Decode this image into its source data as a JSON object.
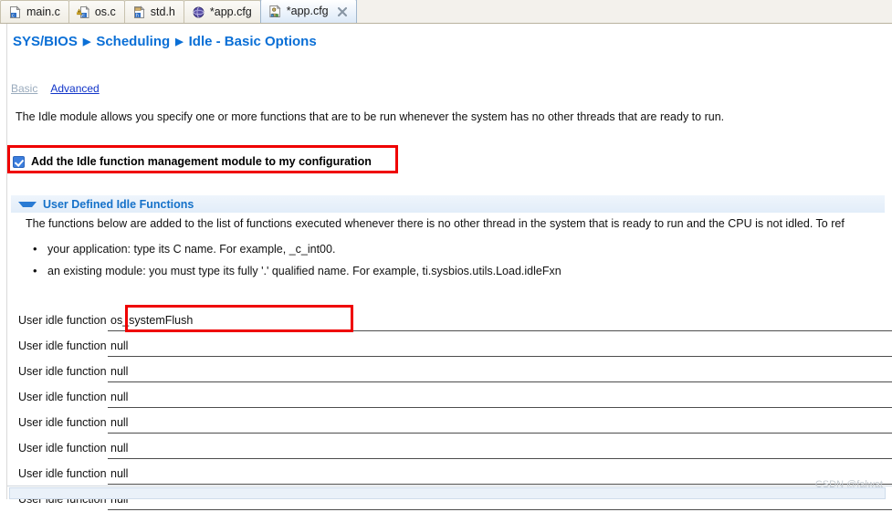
{
  "tabs": [
    {
      "label": "main.c",
      "icon": "c-file-icon",
      "active": false,
      "closable": false
    },
    {
      "label": "os.c",
      "icon": "c-file-warning-icon",
      "active": false,
      "closable": false
    },
    {
      "label": "std.h",
      "icon": "h-file-icon",
      "active": false,
      "closable": false
    },
    {
      "label": "*app.cfg",
      "icon": "globe-icon",
      "active": false,
      "closable": false
    },
    {
      "label": "*app.cfg",
      "icon": "cfg-editor-icon",
      "active": true,
      "closable": true
    }
  ],
  "breadcrumb": {
    "items": [
      "SYS/BIOS",
      "Scheduling",
      "Idle - Basic Options"
    ],
    "separator": "▶"
  },
  "sublinks": [
    {
      "label": "Basic",
      "state": "current"
    },
    {
      "label": "Advanced",
      "state": "link"
    }
  ],
  "description": "The Idle module allows you specify one or more functions that are to be run whenever the system has no other threads that are ready to run.",
  "checkbox": {
    "label": "Add the Idle function management module to my configuration",
    "checked": true
  },
  "section": {
    "title": "User Defined Idle Functions",
    "expanded": true,
    "description": "The functions below are added to the list of functions executed whenever there is no other thread in the system that is ready to run and the CPU is not idled. To ref",
    "bullets": [
      "your application: type its C name. For example, _c_int00.",
      "an existing module: you must type its fully '.' qualified name. For example, ti.sysbios.utils.Load.idleFxn"
    ]
  },
  "fields": [
    {
      "label": "User idle function 0",
      "value": "os_systemFlush",
      "highlighted": true
    },
    {
      "label": "User idle function 1",
      "value": "null",
      "highlighted": false
    },
    {
      "label": "User idle function 2",
      "value": "null",
      "highlighted": false
    },
    {
      "label": "User idle function 3",
      "value": "null",
      "highlighted": false
    },
    {
      "label": "User idle function 4",
      "value": "null",
      "highlighted": false
    },
    {
      "label": "User idle function 5",
      "value": "null",
      "highlighted": false
    },
    {
      "label": "User idle function 6",
      "value": "null",
      "highlighted": false
    },
    {
      "label": "User idle function 7",
      "value": "null",
      "highlighted": false
    }
  ],
  "watermark": "CSDN @falwat",
  "colors": {
    "breadcrumb_blue": "#0a6fd6",
    "section_blue": "#1571c9",
    "link_blue": "#1034c8",
    "current_link_gray": "#9aabbd",
    "annotation_red": "#ef0000",
    "checkbox_blue": "#3b7ddd"
  }
}
